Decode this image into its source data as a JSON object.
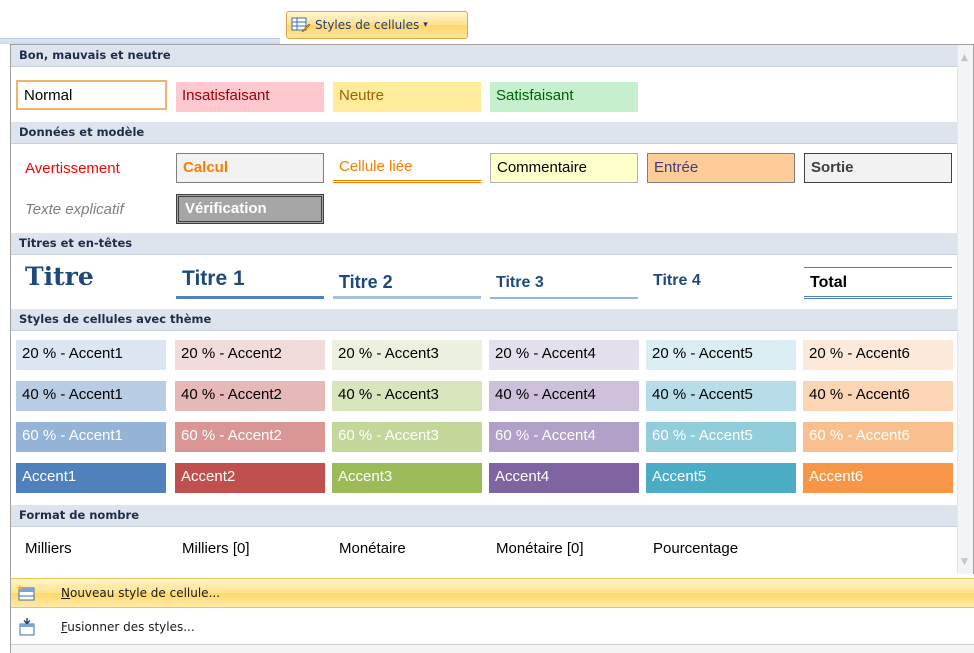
{
  "ribbon": {
    "button_label": "Styles de cellules",
    "button_icon": "cell-styles-icon",
    "caret": "▾"
  },
  "sections": {
    "good_bad": "Bon, mauvais et neutre",
    "data_model": "Données et modèle",
    "titles": "Titres et en-têtes",
    "themed": "Styles de cellules avec thème",
    "number_format": "Format de nombre"
  },
  "good_bad": [
    "Normal",
    "Insatisfaisant",
    "Neutre",
    "Satisfaisant"
  ],
  "data_model_row1": [
    "Avertissement",
    "Calcul",
    "Cellule liée",
    "Commentaire",
    "Entrée",
    "Sortie"
  ],
  "data_model_row2": [
    "Texte explicatif",
    "Vérification"
  ],
  "titles": [
    "Titre",
    "Titre 1",
    "Titre 2",
    "Titre 3",
    "Titre 4",
    "Total"
  ],
  "themed_20": [
    "20 % - Accent1",
    "20 % - Accent2",
    "20 % - Accent3",
    "20 % - Accent4",
    "20 % - Accent5",
    "20 % - Accent6"
  ],
  "themed_40": [
    "40 % - Accent1",
    "40 % - Accent2",
    "40 % - Accent3",
    "40 % - Accent4",
    "40 % - Accent5",
    "40 % - Accent6"
  ],
  "themed_60": [
    "60 % - Accent1",
    "60 % - Accent2",
    "60 % - Accent3",
    "60 % - Accent4",
    "60 % - Accent5",
    "60 % - Accent6"
  ],
  "themed_100": [
    "Accent1",
    "Accent2",
    "Accent3",
    "Accent4",
    "Accent5",
    "Accent6"
  ],
  "number_format": [
    "Milliers",
    "Milliers [0]",
    "Monétaire",
    "Monétaire [0]",
    "Pourcentage"
  ],
  "menu": {
    "new_style": "Nouveau style de cellule...",
    "merge_styles": "Fusionner des styles..."
  },
  "colors": {
    "accent1": "#4f81bd",
    "accent2": "#c0504d",
    "accent3": "#9bbb59",
    "accent4": "#8064a2",
    "accent5": "#4bacc6",
    "accent6": "#f79646",
    "bad_fill": "#ffc7ce",
    "bad_text": "#9c0006",
    "neutral_fill": "#ffeb9c",
    "neutral_text": "#9c6500",
    "good_fill": "#c6efce",
    "good_text": "#006100"
  }
}
